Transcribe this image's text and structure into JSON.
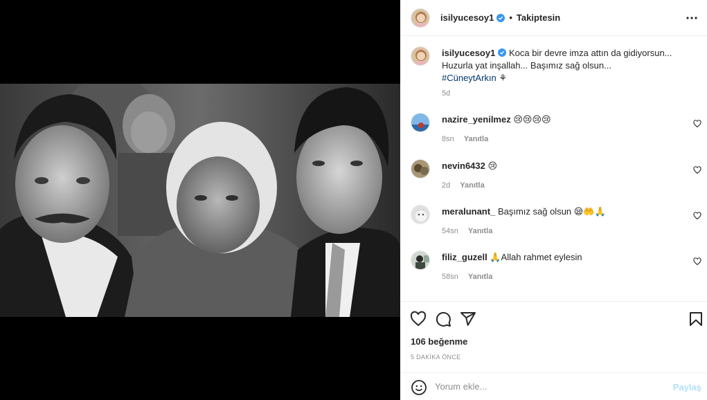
{
  "post": {
    "username": "isilyucesoy1",
    "follow_status": "Takiptesin",
    "separator": "•"
  },
  "caption": {
    "username": "isilyucesoy1",
    "line1": "Koca bir devre imza attın da gidiyorsun...",
    "line2": "Huzurla yat inşallah... Başımız sağ olsun...",
    "hashtag": "#CüneytArkın",
    "trailing": "⚘",
    "age": "5d"
  },
  "comments": [
    {
      "username": "nazire_yenilmez",
      "text": "😢😢😢😢",
      "age": "8sn",
      "reply": "Yanıtla"
    },
    {
      "username": "nevin6432",
      "text": "😢",
      "age": "2d",
      "reply": "Yanıtla"
    },
    {
      "username": "meralunant_",
      "text": "Başımız sağ olsun 😪🤲🙏",
      "age": "54sn",
      "reply": "Yanıtla"
    },
    {
      "username": "filiz_guzell",
      "text": "🙏Allah rahmet eylesin",
      "age": "58sn",
      "reply": "Yanıtla"
    }
  ],
  "footer": {
    "likes": "106 beğenme",
    "time": "5 DAKİKA ÖNCE",
    "comment_placeholder": "Yorum ekle...",
    "share_label": "Paylaş"
  },
  "colors": {
    "verified": "#3897f0",
    "link": "#00376b",
    "share_disabled": "#b2dffc",
    "muted": "#8e8e8e"
  },
  "icons": [
    "more-options-icon",
    "verified-icon",
    "like-icon",
    "comment-icon",
    "share-icon",
    "save-icon",
    "emoji-icon",
    "comment-like-icon"
  ]
}
